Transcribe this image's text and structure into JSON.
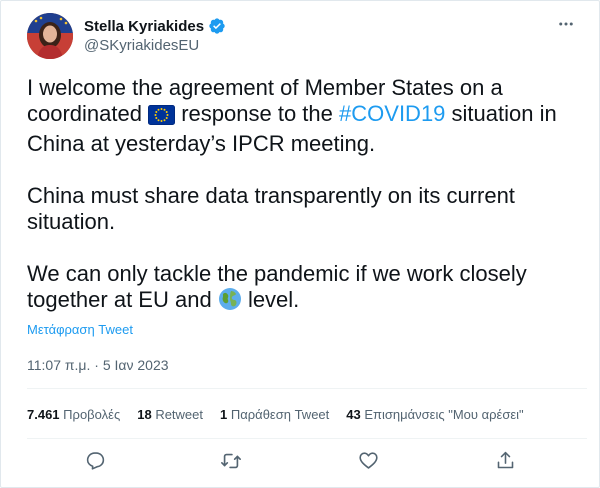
{
  "tweet": {
    "author": {
      "display_name": "Stella Kyriakides",
      "handle": "@SKyriakidesEU",
      "avatar_icon": "profile-photo"
    },
    "more_icon": "more-horizontal-icon",
    "paragraphs": {
      "p1": {
        "before_flag": "I welcome the agreement of Member States on a coordinated",
        "flag_icon": "eu-flag-emoji",
        "after_flag": "response to the",
        "hashtag": "#COVID19",
        "end": "situation in China at yesterday’s IPCR meeting."
      },
      "p2": "China must share data transparently on its current situation.",
      "p3": {
        "before_globe": "We can only tackle the pandemic if we work closely together at EU and",
        "globe_icon": "globe-emoji",
        "after_globe": "level."
      }
    },
    "translate_label": "Μετάφραση Tweet",
    "timestamp": "11:07 π.μ. · 5 Ιαν 2023",
    "stats": {
      "views_count": "7.461",
      "views_label": "Προβολές",
      "retweets_count": "18",
      "retweets_label": "Retweet",
      "quotes_count": "1",
      "quotes_label": "Παράθεση Tweet",
      "likes_count": "43",
      "likes_label": "Επισημάνσεις \"Μου αρέσει\""
    },
    "actions": {
      "reply_icon": "reply-icon",
      "retweet_icon": "retweet-icon",
      "like_icon": "heart-icon",
      "share_icon": "share-icon"
    },
    "colors": {
      "link": "#1d9bf0",
      "text": "#0f1419",
      "muted": "#536471",
      "divider": "#eff3f4"
    }
  }
}
